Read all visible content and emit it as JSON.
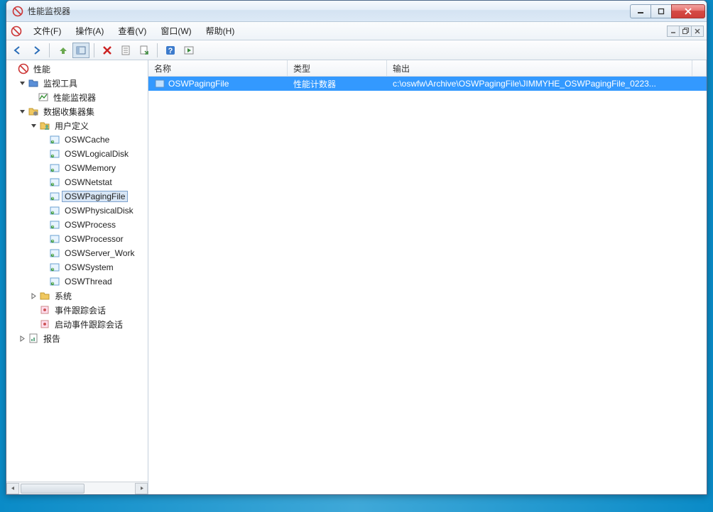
{
  "window": {
    "title": "性能监视器"
  },
  "menu": {
    "file": "文件(F)",
    "action": "操作(A)",
    "view": "查看(V)",
    "window": "窗口(W)",
    "help": "帮助(H)"
  },
  "tree": {
    "root": "性能",
    "monitor_tools": "监视工具",
    "perf_monitor": "性能监视器",
    "collector_sets": "数据收集器集",
    "user_defined": "用户定义",
    "items": [
      "OSWCache",
      "OSWLogicalDisk",
      "OSWMemory",
      "OSWNetstat",
      "OSWPagingFile",
      "OSWPhysicalDisk",
      "OSWProcess",
      "OSWProcessor",
      "OSWServer_Work",
      "OSWSystem",
      "OSWThread"
    ],
    "system": "系统",
    "event_session": "事件跟踪会话",
    "startup_event_session": "启动事件跟踪会话",
    "reports": "报告"
  },
  "selected_tree_item": "OSWPagingFile",
  "columns": {
    "name": "名称",
    "type": "类型",
    "output": "输出"
  },
  "rows": [
    {
      "name": "OSWPagingFile",
      "type": "性能计数器",
      "output": "c:\\oswfw\\Archive\\OSWPagingFile\\JIMMYHE_OSWPagingFile_0223..."
    }
  ]
}
